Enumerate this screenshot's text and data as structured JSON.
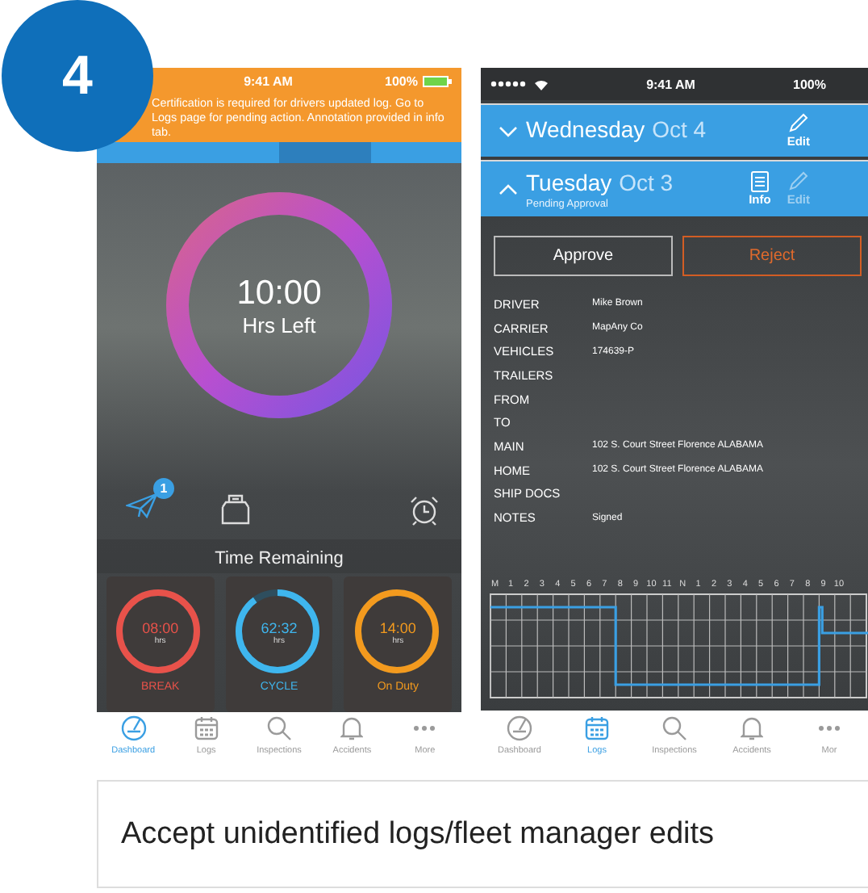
{
  "step_badge": "4",
  "dashboard_phone": {
    "status_bar": {
      "time": "9:41 AM",
      "battery": "100%"
    },
    "notice": "Certification is required for drivers updated log. Go to Logs page for pending action. Annotation provided in info tab.",
    "tabs": [
      {
        "selected": false
      },
      {
        "selected": false
      },
      {
        "selected": true
      },
      {
        "selected": false
      }
    ],
    "hours_ring": {
      "value": "10:00",
      "label": "Hrs Left",
      "level": 1
    },
    "messages_badge": "1",
    "section_title": "Time Remaining",
    "timers": [
      {
        "value": "08:00",
        "unit": "hrs",
        "label": "BREAK",
        "color": "#e8524a",
        "level": 1
      },
      {
        "value": "62:32",
        "unit": "hrs",
        "label": "CYCLE",
        "color": "#3fb6ee",
        "level": 0.9
      },
      {
        "value": "14:00",
        "unit": "hrs",
        "label": "On Duty",
        "color": "#f39a1e",
        "level": 1
      }
    ],
    "tab_bar": [
      {
        "label": "Dashboard",
        "kind": "dashboard",
        "selected": true
      },
      {
        "label": "Logs",
        "kind": "logs",
        "selected": false
      },
      {
        "label": "Inspections",
        "kind": "inspections",
        "selected": false
      },
      {
        "label": "Accidents",
        "kind": "accidents",
        "selected": false
      },
      {
        "label": "More",
        "kind": "more",
        "selected": false
      }
    ]
  },
  "logs_phone": {
    "status_bar": {
      "time": "9:41 AM",
      "battery": "100%"
    },
    "days": [
      {
        "day": "Wednesday",
        "date": "Oct 4",
        "expanded": false,
        "actions": [
          {
            "label": "Edit",
            "kind": "edit",
            "disabled": false
          }
        ]
      },
      {
        "day": "Tuesday",
        "date": "Oct 3",
        "status": "Pending Approval",
        "expanded": true,
        "actions": [
          {
            "label": "Info",
            "kind": "info",
            "disabled": false
          },
          {
            "label": "Edit",
            "kind": "edit",
            "disabled": true
          }
        ]
      }
    ],
    "buttons": [
      {
        "label": "Approve",
        "kind": "approve"
      },
      {
        "label": "Reject",
        "kind": "reject"
      }
    ],
    "details": [
      {
        "label": "DRIVER",
        "value": "Mike Brown"
      },
      {
        "label": "CARRIER",
        "value": "MapAny Co"
      },
      {
        "label": "VEHICLES",
        "value": "174639-P"
      },
      {
        "label": "TRAILERS"
      },
      {
        "label": "FROM"
      },
      {
        "label": "TO"
      },
      {
        "label": "MAIN",
        "value": "102 S. Court Street Florence ALABAMA"
      },
      {
        "label": "HOME",
        "value": "102 S. Court Street Florence ALABAMA"
      },
      {
        "label": "SHIP DOCS"
      },
      {
        "label": "NOTES",
        "value": "Signed"
      }
    ],
    "hour_labels": [
      "M",
      "1",
      "2",
      "3",
      "4",
      "5",
      "6",
      "7",
      "8",
      "9",
      "10",
      "11",
      "N",
      "1",
      "2",
      "3",
      "4",
      "5",
      "6",
      "7",
      "8",
      "9",
      "10"
    ],
    "tab_bar": [
      {
        "label": "Dashboard",
        "kind": "dashboard",
        "selected": false
      },
      {
        "label": "Logs",
        "kind": "logs",
        "selected": true
      },
      {
        "label": "Inspections",
        "kind": "inspections",
        "selected": false
      },
      {
        "label": "Accidents",
        "kind": "accidents",
        "selected": false
      },
      {
        "label": "Mor",
        "kind": "more",
        "selected": false
      }
    ]
  },
  "caption": "Accept unidentified logs/fleet manager edits"
}
